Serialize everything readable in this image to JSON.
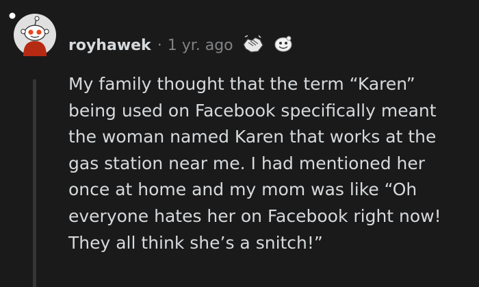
{
  "comment": {
    "username": "royhawek",
    "separator": "·",
    "timestamp": "1 yr. ago",
    "awards": [
      "helpful-handshake-award-icon",
      "smile-award-icon"
    ],
    "body_lines": [
      "My family thought that the term “Karen”",
      "being used on Facebook specifically meant",
      "the woman named Karen that works at the",
      "gas station near me. I had mentioned her",
      "once at home and my mom was like “Oh",
      "everyone hates her on Facebook right now!",
      "They all think she’s a snitch!”"
    ]
  },
  "colors": {
    "background": "#1a1a1b",
    "text": "#d7dadc",
    "muted": "#818384",
    "thread_line": "#343536",
    "snoo_red": "#cc3300"
  }
}
